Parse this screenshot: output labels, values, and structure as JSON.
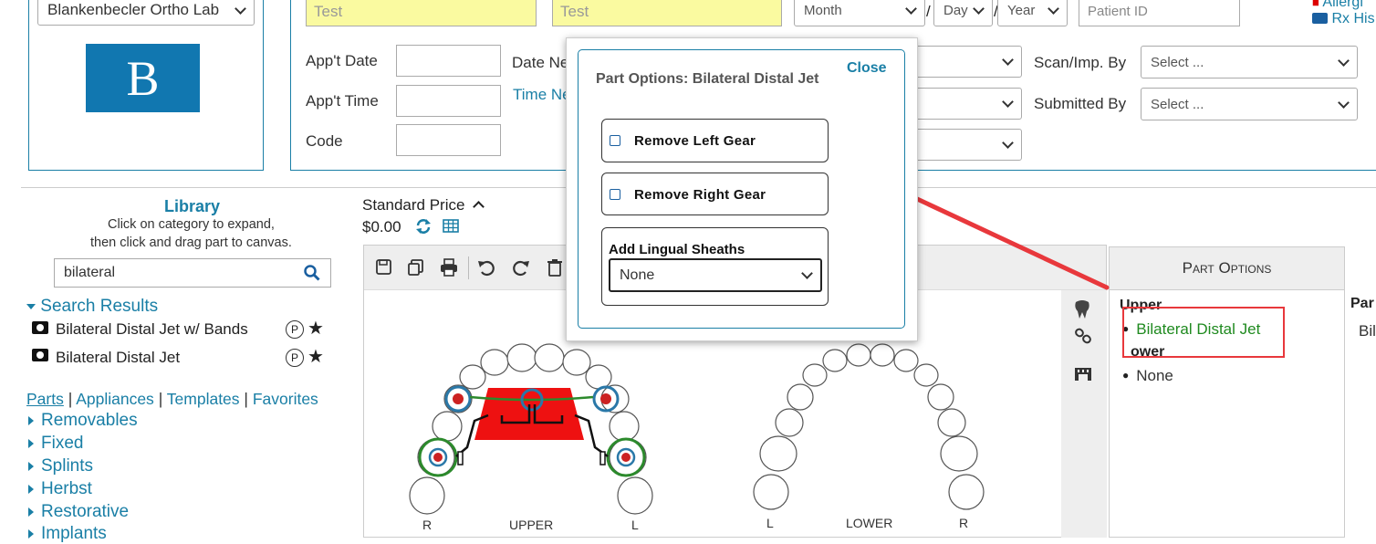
{
  "top": {
    "lab_select": "Blankenbecler Ortho Lab",
    "logo_letter": "B",
    "first_name": "Test",
    "last_name": "Test",
    "month": "Month",
    "day": "Day",
    "year": "Year",
    "sep1": "/",
    "sep2": "/",
    "patient_id_placeholder": "Patient ID",
    "allergies": "Allergi",
    "rx_history": "Rx His"
  },
  "form": {
    "appt_date": "App't Date",
    "appt_time": "App't Time",
    "code": "Code",
    "date_needed": "Date Ne",
    "time_needed": "Time Ne",
    "scan_by": "Scan/Imp. By",
    "submitted_by": "Submitted By",
    "select_placeholder": "Select ..."
  },
  "library": {
    "title": "Library",
    "hint1": "Click on category to expand,",
    "hint2": "then click and drag part to canvas.",
    "search_value": "bilateral",
    "results_header": "Search Results",
    "results": [
      {
        "name": "Bilateral Distal Jet w/ Bands",
        "badge": "P"
      },
      {
        "name": "Bilateral Distal Jet",
        "badge": "P"
      }
    ],
    "tabs": [
      "Parts",
      "Appliances",
      "Templates",
      "Favorites"
    ],
    "tab_sep": "|",
    "categories": [
      "Removables",
      "Fixed",
      "Splints",
      "Herbst",
      "Restorative",
      "Implants"
    ]
  },
  "price": {
    "label": "Standard Price",
    "value": "$0.00"
  },
  "canvas": {
    "upper_label": "UPPER",
    "lower_label": "LOWER",
    "r": "R",
    "l": "L"
  },
  "part_options_panel": {
    "header": "Part Options",
    "upper_heading": "Upper",
    "upper_item": "Bilateral Distal Jet",
    "lower_heading": "ower",
    "lower_item": "None",
    "extra_col_heading": "Par",
    "extra_col_item": "Bil"
  },
  "modal": {
    "title": "Part Options: Bilateral Distal Jet",
    "close": "Close",
    "option1": "Remove Left Gear",
    "option2": "Remove Right Gear",
    "sheaths_label": "Add Lingual Sheaths",
    "sheaths_value": "None"
  },
  "colors": {
    "accent": "#1a7fa6",
    "highlight_input": "#fafaa0",
    "annotation": "#e8383c",
    "green_text": "#1f8a1f"
  }
}
